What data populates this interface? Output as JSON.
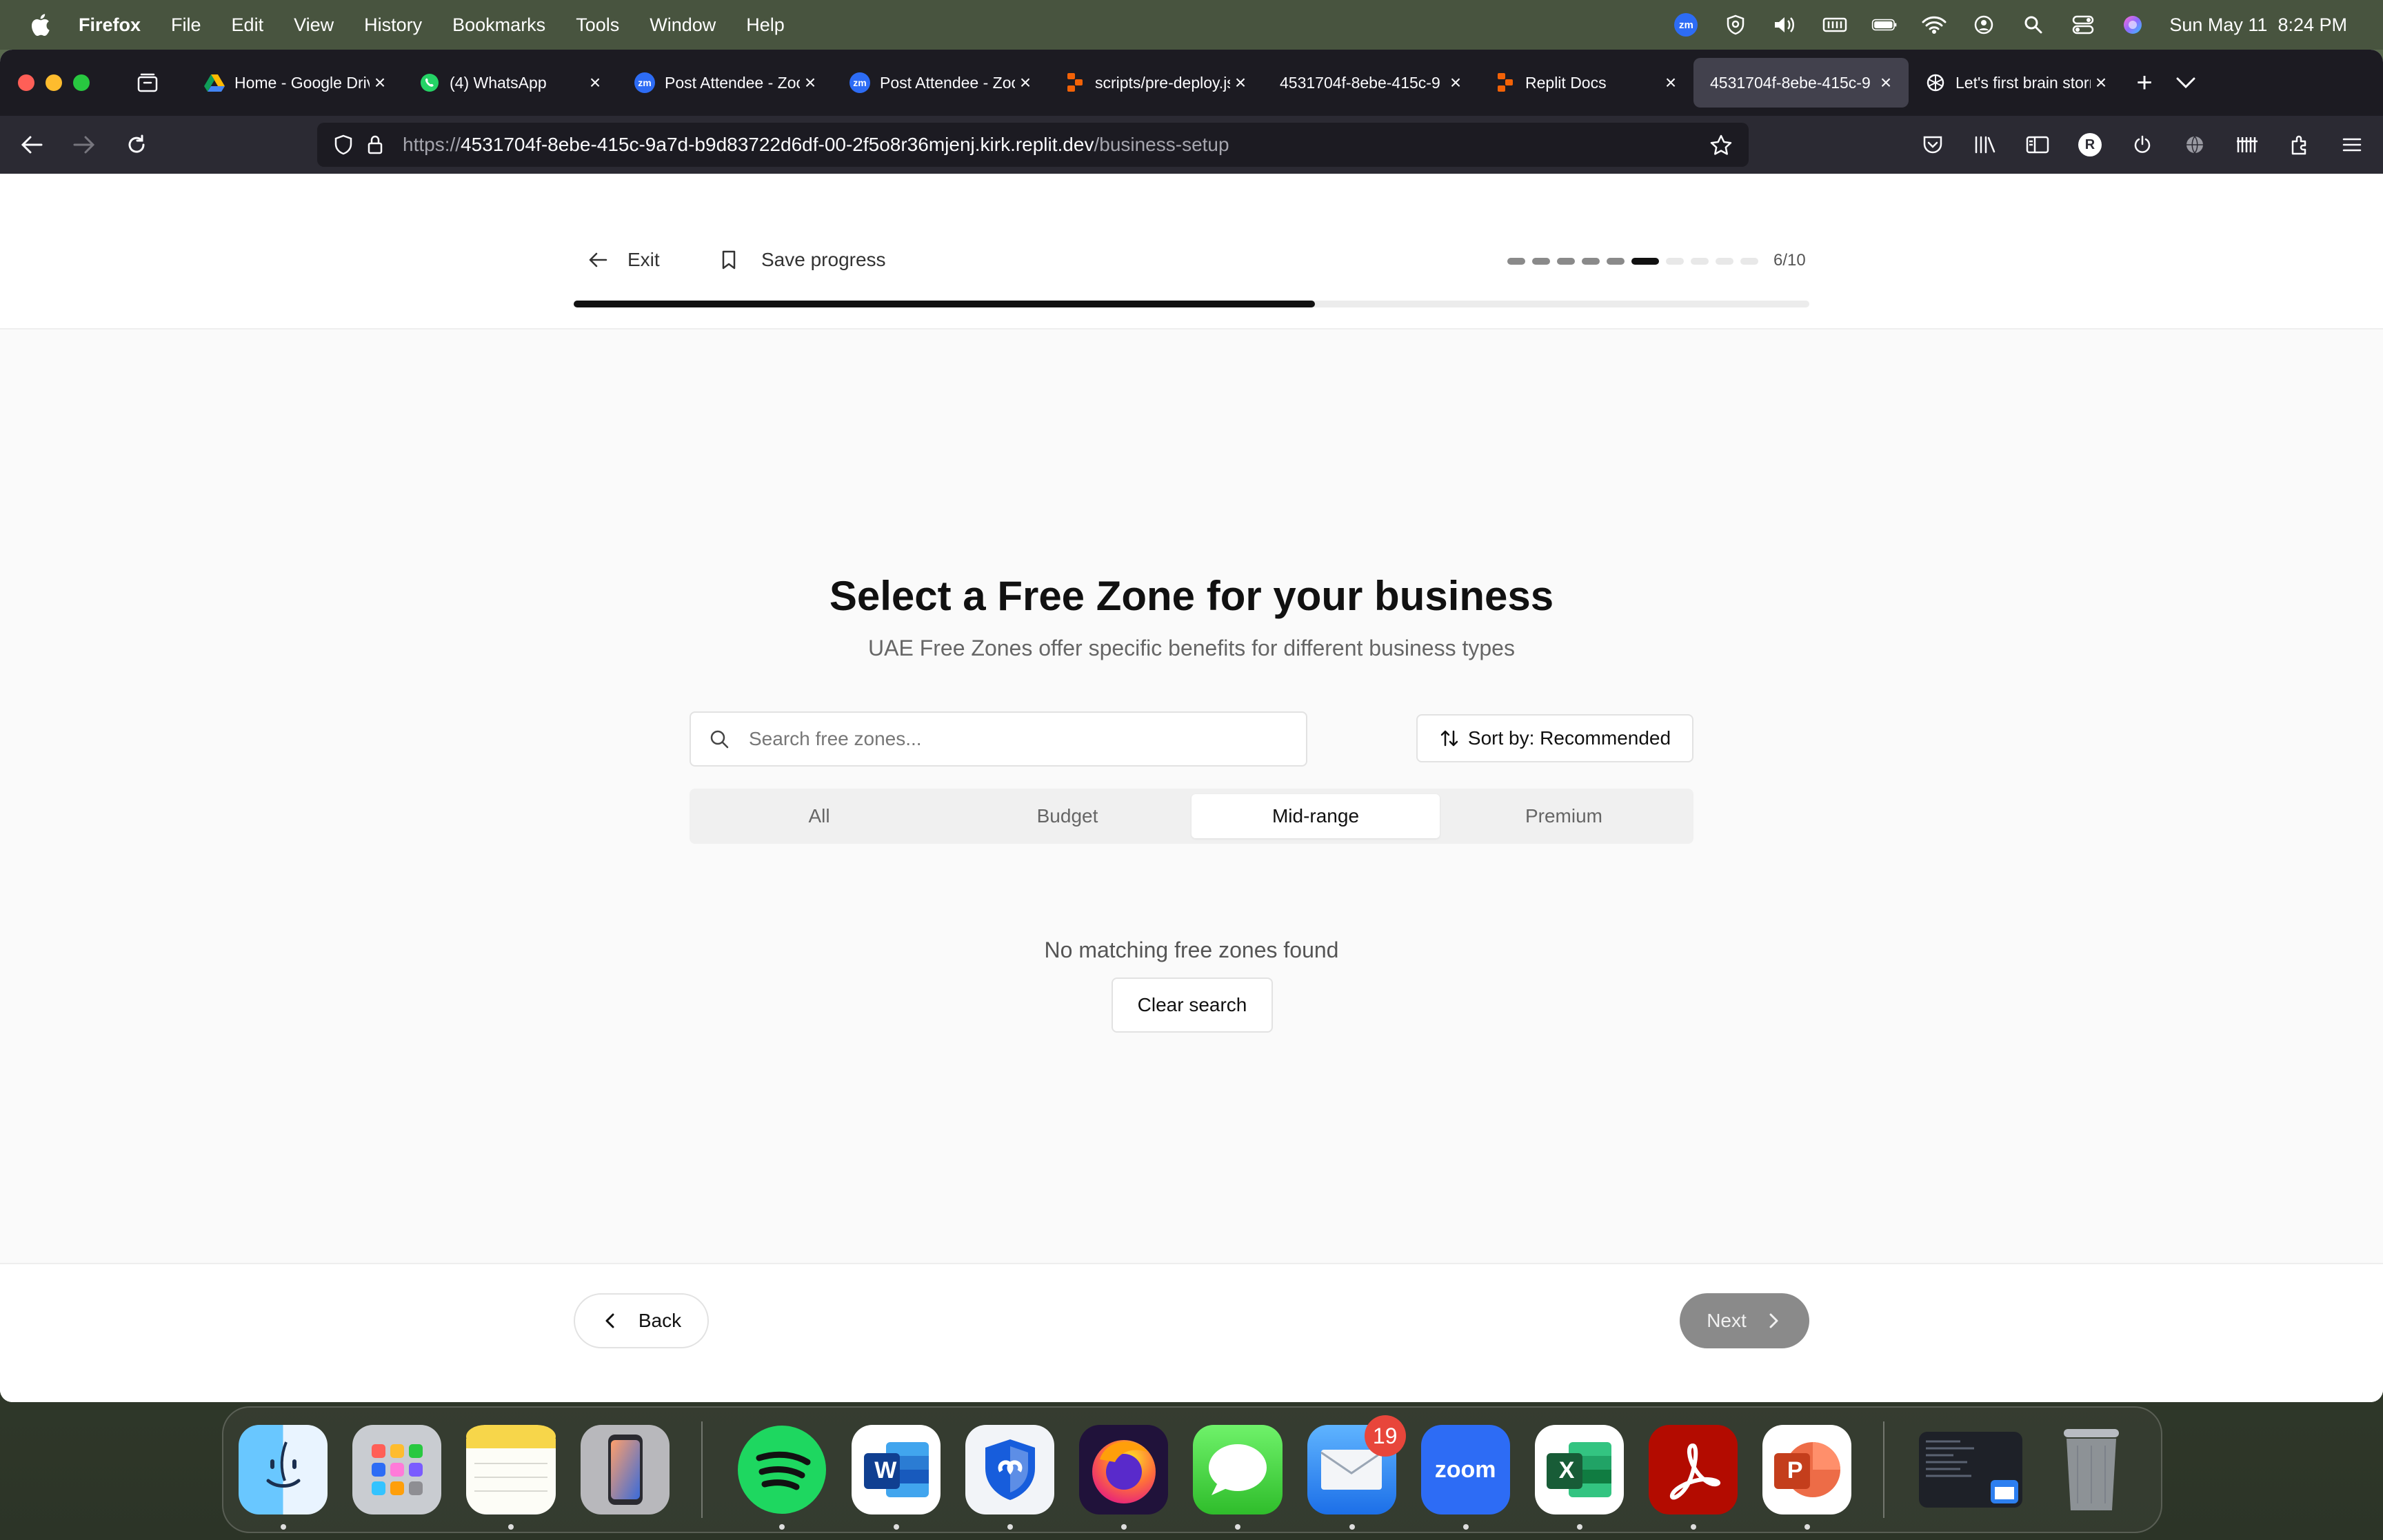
{
  "menubar": {
    "app_name": "Firefox",
    "menus": [
      "File",
      "Edit",
      "View",
      "History",
      "Bookmarks",
      "Tools",
      "Window",
      "Help"
    ],
    "datetime": "Sun May 11  8:24 PM",
    "zoom_badge": "zm"
  },
  "browser": {
    "tabs": [
      {
        "title": "Home - Google Drive",
        "favicon": "google-drive-icon"
      },
      {
        "title": "(4) WhatsApp",
        "favicon": "whatsapp-icon"
      },
      {
        "title": "Post Attendee - Zoom",
        "favicon": "zoom-icon"
      },
      {
        "title": "Post Attendee - Zoom",
        "favicon": "zoom-icon"
      },
      {
        "title": "scripts/pre-deploy.js",
        "favicon": "replit-icon"
      },
      {
        "title": "4531704f-8ebe-415c-9",
        "favicon": "none"
      },
      {
        "title": "Replit Docs",
        "favicon": "replit-icon"
      },
      {
        "title": "4531704f-8ebe-415c-9",
        "favicon": "none",
        "active": true
      },
      {
        "title": "Let's first brain storm",
        "favicon": "openai-icon"
      }
    ],
    "zoom_fav": "zm",
    "url_prefix": "https://",
    "url_host": "4531704f-8ebe-415c-9a7d-b9d83722d6df-00-2f5o8r36mjenj.kirk.replit.dev",
    "url_path": "/business-setup",
    "profile_initial": "R"
  },
  "page": {
    "exit_label": "Exit",
    "save_label": "Save progress",
    "step_label": "6/10",
    "step_current": 6,
    "step_total": 10,
    "progress_fraction": 0.6,
    "heading": "Select a Free Zone for your business",
    "subheading": "UAE Free Zones offer specific benefits for different business types",
    "search_placeholder": "Search free zones...",
    "sort_label": "Sort by: Recommended",
    "filter_tabs": [
      "All",
      "Budget",
      "Mid-range",
      "Premium"
    ],
    "active_filter": "Mid-range",
    "empty_message": "No matching free zones found",
    "clear_label": "Clear search",
    "back_label": "Back",
    "next_label": "Next"
  },
  "dock": {
    "apps": [
      "Finder",
      "Launchpad",
      "Notes",
      "iPhone Mirroring",
      "Spotify",
      "Microsoft Word",
      "Bitwarden",
      "Firefox",
      "Messages",
      "Mail",
      "Zoom",
      "Microsoft Excel",
      "Adobe Acrobat",
      "Microsoft PowerPoint"
    ],
    "mail_badge": "19",
    "zoom_text": "zoom",
    "word_letter": "W",
    "excel_letter": "X",
    "ppt_letter": "P"
  },
  "colors": {
    "accent": "#111111",
    "next_disabled": "#8a8a8a",
    "browser_chrome": "#1c1b22"
  }
}
